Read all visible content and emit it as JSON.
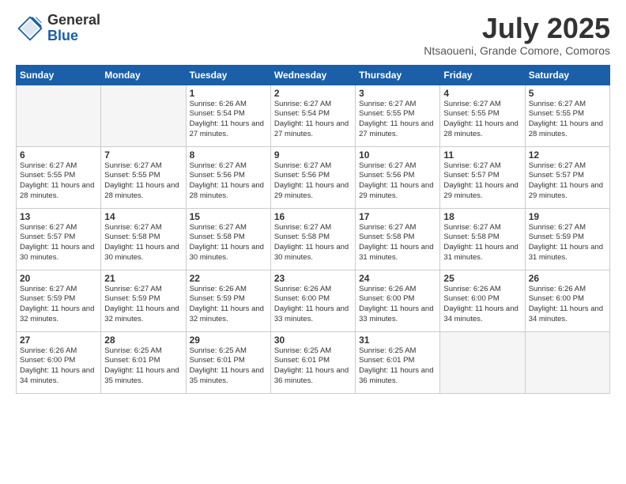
{
  "header": {
    "logo_general": "General",
    "logo_blue": "Blue",
    "month_title": "July 2025",
    "location": "Ntsaoueni, Grande Comore, Comoros"
  },
  "weekdays": [
    "Sunday",
    "Monday",
    "Tuesday",
    "Wednesday",
    "Thursday",
    "Friday",
    "Saturday"
  ],
  "weeks": [
    [
      {
        "day": "",
        "info": ""
      },
      {
        "day": "",
        "info": ""
      },
      {
        "day": "1",
        "info": "Sunrise: 6:26 AM\nSunset: 5:54 PM\nDaylight: 11 hours and 27 minutes."
      },
      {
        "day": "2",
        "info": "Sunrise: 6:27 AM\nSunset: 5:54 PM\nDaylight: 11 hours and 27 minutes."
      },
      {
        "day": "3",
        "info": "Sunrise: 6:27 AM\nSunset: 5:55 PM\nDaylight: 11 hours and 27 minutes."
      },
      {
        "day": "4",
        "info": "Sunrise: 6:27 AM\nSunset: 5:55 PM\nDaylight: 11 hours and 28 minutes."
      },
      {
        "day": "5",
        "info": "Sunrise: 6:27 AM\nSunset: 5:55 PM\nDaylight: 11 hours and 28 minutes."
      }
    ],
    [
      {
        "day": "6",
        "info": "Sunrise: 6:27 AM\nSunset: 5:55 PM\nDaylight: 11 hours and 28 minutes."
      },
      {
        "day": "7",
        "info": "Sunrise: 6:27 AM\nSunset: 5:55 PM\nDaylight: 11 hours and 28 minutes."
      },
      {
        "day": "8",
        "info": "Sunrise: 6:27 AM\nSunset: 5:56 PM\nDaylight: 11 hours and 28 minutes."
      },
      {
        "day": "9",
        "info": "Sunrise: 6:27 AM\nSunset: 5:56 PM\nDaylight: 11 hours and 29 minutes."
      },
      {
        "day": "10",
        "info": "Sunrise: 6:27 AM\nSunset: 5:56 PM\nDaylight: 11 hours and 29 minutes."
      },
      {
        "day": "11",
        "info": "Sunrise: 6:27 AM\nSunset: 5:57 PM\nDaylight: 11 hours and 29 minutes."
      },
      {
        "day": "12",
        "info": "Sunrise: 6:27 AM\nSunset: 5:57 PM\nDaylight: 11 hours and 29 minutes."
      }
    ],
    [
      {
        "day": "13",
        "info": "Sunrise: 6:27 AM\nSunset: 5:57 PM\nDaylight: 11 hours and 30 minutes."
      },
      {
        "day": "14",
        "info": "Sunrise: 6:27 AM\nSunset: 5:58 PM\nDaylight: 11 hours and 30 minutes."
      },
      {
        "day": "15",
        "info": "Sunrise: 6:27 AM\nSunset: 5:58 PM\nDaylight: 11 hours and 30 minutes."
      },
      {
        "day": "16",
        "info": "Sunrise: 6:27 AM\nSunset: 5:58 PM\nDaylight: 11 hours and 30 minutes."
      },
      {
        "day": "17",
        "info": "Sunrise: 6:27 AM\nSunset: 5:58 PM\nDaylight: 11 hours and 31 minutes."
      },
      {
        "day": "18",
        "info": "Sunrise: 6:27 AM\nSunset: 5:58 PM\nDaylight: 11 hours and 31 minutes."
      },
      {
        "day": "19",
        "info": "Sunrise: 6:27 AM\nSunset: 5:59 PM\nDaylight: 11 hours and 31 minutes."
      }
    ],
    [
      {
        "day": "20",
        "info": "Sunrise: 6:27 AM\nSunset: 5:59 PM\nDaylight: 11 hours and 32 minutes."
      },
      {
        "day": "21",
        "info": "Sunrise: 6:27 AM\nSunset: 5:59 PM\nDaylight: 11 hours and 32 minutes."
      },
      {
        "day": "22",
        "info": "Sunrise: 6:26 AM\nSunset: 5:59 PM\nDaylight: 11 hours and 32 minutes."
      },
      {
        "day": "23",
        "info": "Sunrise: 6:26 AM\nSunset: 6:00 PM\nDaylight: 11 hours and 33 minutes."
      },
      {
        "day": "24",
        "info": "Sunrise: 6:26 AM\nSunset: 6:00 PM\nDaylight: 11 hours and 33 minutes."
      },
      {
        "day": "25",
        "info": "Sunrise: 6:26 AM\nSunset: 6:00 PM\nDaylight: 11 hours and 34 minutes."
      },
      {
        "day": "26",
        "info": "Sunrise: 6:26 AM\nSunset: 6:00 PM\nDaylight: 11 hours and 34 minutes."
      }
    ],
    [
      {
        "day": "27",
        "info": "Sunrise: 6:26 AM\nSunset: 6:00 PM\nDaylight: 11 hours and 34 minutes."
      },
      {
        "day": "28",
        "info": "Sunrise: 6:25 AM\nSunset: 6:01 PM\nDaylight: 11 hours and 35 minutes."
      },
      {
        "day": "29",
        "info": "Sunrise: 6:25 AM\nSunset: 6:01 PM\nDaylight: 11 hours and 35 minutes."
      },
      {
        "day": "30",
        "info": "Sunrise: 6:25 AM\nSunset: 6:01 PM\nDaylight: 11 hours and 36 minutes."
      },
      {
        "day": "31",
        "info": "Sunrise: 6:25 AM\nSunset: 6:01 PM\nDaylight: 11 hours and 36 minutes."
      },
      {
        "day": "",
        "info": ""
      },
      {
        "day": "",
        "info": ""
      }
    ]
  ]
}
